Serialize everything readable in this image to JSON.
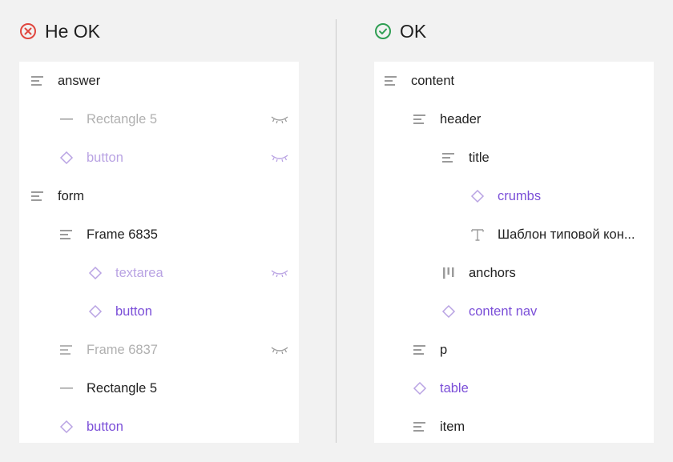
{
  "left": {
    "title": "Не OK",
    "rows": [
      {
        "label": "answer",
        "icon": "frame-icon"
      },
      {
        "label": "Rectangle 5",
        "icon": "line-icon",
        "hidden": true
      },
      {
        "label": "button",
        "icon": "component-instance-icon",
        "hidden": true
      },
      {
        "label": "form",
        "icon": "frame-icon"
      },
      {
        "label": "Frame 6835",
        "icon": "frame-icon"
      },
      {
        "label": "textarea",
        "icon": "component-instance-icon",
        "hidden": true
      },
      {
        "label": "button",
        "icon": "component-instance-icon"
      },
      {
        "label": "Frame 6837",
        "icon": "frame-icon",
        "hidden": true
      },
      {
        "label": "Rectangle 5",
        "icon": "line-icon"
      },
      {
        "label": "button",
        "icon": "component-instance-icon"
      }
    ]
  },
  "right": {
    "title": "OK",
    "rows": [
      {
        "label": "content",
        "icon": "frame-icon"
      },
      {
        "label": "header",
        "icon": "frame-icon"
      },
      {
        "label": "title",
        "icon": "frame-icon"
      },
      {
        "label": "crumbs",
        "icon": "component-instance-icon"
      },
      {
        "label": "Шаблон типовой кон...",
        "icon": "text-icon"
      },
      {
        "label": "anchors",
        "icon": "horizontal-layout-icon"
      },
      {
        "label": "content nav",
        "icon": "component-instance-icon"
      },
      {
        "label": "p",
        "icon": "frame-icon"
      },
      {
        "label": "table",
        "icon": "component-instance-icon"
      },
      {
        "label": "item",
        "icon": "frame-icon"
      }
    ]
  },
  "colors": {
    "bad": "#e0463e",
    "good": "#2f9e53",
    "purple": "#7b4fd8",
    "light_purple": "#b9a3e3",
    "grey_text": "#b0b0b0"
  }
}
